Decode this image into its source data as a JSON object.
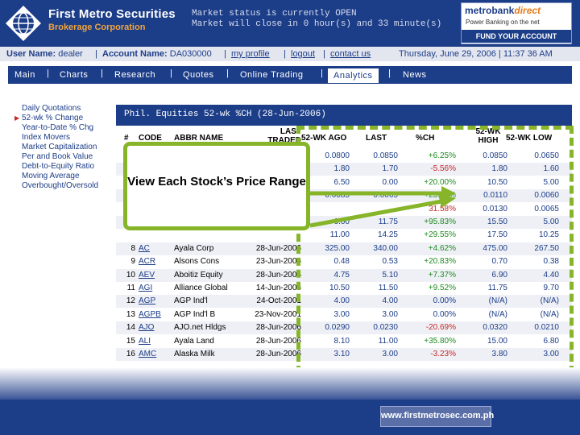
{
  "header": {
    "brand_name": "First Metro Securities",
    "brand_sub": "Brokerage Corporation",
    "market_status": "Market status is currently OPEN",
    "market_close": "Market will close in 0 hour(s) and 33 minute(s)",
    "ad": {
      "name_part1": "metrobank",
      "name_part2": "direct",
      "tagline": "Power Banking on the net",
      "cta": "FUND YOUR ACCOUNT"
    }
  },
  "userbar": {
    "user_label": "User Name:",
    "user_value": "dealer",
    "account_label": "Account Name:",
    "account_value": "DA030000",
    "links": {
      "profile": "my profile",
      "logout": "logout",
      "contact": "contact us"
    },
    "sep": "|",
    "datetime": "Thursday, June 29, 2006 | 11:37 36 AM"
  },
  "nav": {
    "items": [
      "Main",
      "Charts",
      "Research",
      "Quotes",
      "Online Trading",
      "Analytics",
      "News"
    ],
    "active": "Analytics",
    "sep": "|"
  },
  "left_menu": {
    "items": [
      "Daily Quotations",
      "52-wk % Change",
      "Year-to-Date % Chg",
      "Index Movers",
      "Market Capitalization",
      "Per and Book Value",
      "Debt-to-Equity Ratio",
      "Moving Average",
      "Overbought/Oversold"
    ],
    "active_index": 1
  },
  "table": {
    "title": "Phil. Equities 52-wk %CH (28-Jun-2006)",
    "headers": {
      "num": "#",
      "code": "CODE",
      "abbr": "ABBR NAME",
      "last_traded": "LAST TRADED",
      "ago": "52-WK AGO",
      "last": "LAST",
      "pch": "%CH",
      "high": "52-WK HIGH",
      "low": "52-WK LOW"
    },
    "rows": [
      {
        "n": "",
        "code": "",
        "name": "",
        "date": "",
        "ago": "0.0800",
        "last": "0.0850",
        "pch": "+6.25%",
        "high": "0.0850",
        "low": "0.0650",
        "dir": "pos"
      },
      {
        "n": "",
        "code": "",
        "name": "",
        "date": "",
        "ago": "1.80",
        "last": "1.70",
        "pch": "-5.56%",
        "high": "1.80",
        "low": "1.60",
        "dir": "neg"
      },
      {
        "n": "",
        "code": "",
        "name": "",
        "date": "",
        "ago": "6.50",
        "last": "0.00",
        "pch": "+20.00%",
        "high": "10.50",
        "low": "5.00",
        "dir": "pos"
      },
      {
        "n": "",
        "code": "",
        "name": "",
        "date": "",
        "ago": "0.0085",
        "last": "0.0065",
        "pch": "+23.53%",
        "high": "0.0110",
        "low": "0.0060",
        "dir": "pos"
      },
      {
        "n": "",
        "code": "",
        "name": "",
        "date": "",
        "ago": "",
        "last": "",
        "pch": "31.58%",
        "high": "0.0130",
        "low": "0.0065",
        "dir": "neg"
      },
      {
        "n": "",
        "code": "",
        "name": "",
        "date": "",
        "ago": "6.00",
        "last": "11.75",
        "pch": "+95.83%",
        "high": "15.50",
        "low": "5.00",
        "dir": "pos"
      },
      {
        "n": "",
        "code": "",
        "name": "",
        "date": "",
        "ago": "11.00",
        "last": "14.25",
        "pch": "+29.55%",
        "high": "17.50",
        "low": "10.25",
        "dir": "pos"
      },
      {
        "n": "8",
        "code": "AC",
        "name": "Ayala Corp",
        "date": "28-Jun-2006",
        "ago": "325.00",
        "last": "340.00",
        "pch": "+4.62%",
        "high": "475.00",
        "low": "267.50",
        "dir": "pos"
      },
      {
        "n": "9",
        "code": "ACR",
        "name": "Alsons Cons",
        "date": "23-Jun-2006",
        "ago": "0.48",
        "last": "0.53",
        "pch": "+20.83%",
        "high": "0.70",
        "low": "0.38",
        "dir": "pos"
      },
      {
        "n": "10",
        "code": "AEV",
        "name": "Aboitiz Equity",
        "date": "28-Jun-2006",
        "ago": "4.75",
        "last": "5.10",
        "pch": "+7.37%",
        "high": "6.90",
        "low": "4.40",
        "dir": "pos"
      },
      {
        "n": "11",
        "code": "AGI",
        "name": "Alliance Global",
        "date": "14-Jun-2006",
        "ago": "10.50",
        "last": "11.50",
        "pch": "+9.52%",
        "high": "11.75",
        "low": "9.70",
        "dir": "pos"
      },
      {
        "n": "12",
        "code": "AGP",
        "name": "AGP Ind'l",
        "date": "24-Oct-2001",
        "ago": "4.00",
        "last": "4.00",
        "pch": "0.00%",
        "high": "(N/A)",
        "low": "(N/A)",
        "dir": "zero"
      },
      {
        "n": "13",
        "code": "AGPB",
        "name": "AGP Ind'l B",
        "date": "23-Nov-2001",
        "ago": "3.00",
        "last": "3.00",
        "pch": "0.00%",
        "high": "(N/A)",
        "low": "(N/A)",
        "dir": "zero"
      },
      {
        "n": "14",
        "code": "AJO",
        "name": "AJO.net Hldgs",
        "date": "28-Jun-2006",
        "ago": "0.0290",
        "last": "0.0230",
        "pch": "-20.69%",
        "high": "0.0320",
        "low": "0.0210",
        "dir": "neg"
      },
      {
        "n": "15",
        "code": "ALI",
        "name": "Ayala Land",
        "date": "28-Jun-2006",
        "ago": "8.10",
        "last": "11.00",
        "pch": "+35.80%",
        "high": "15.00",
        "low": "6.80",
        "dir": "pos"
      },
      {
        "n": "16",
        "code": "AMC",
        "name": "Alaska Milk",
        "date": "28-Jun-2006",
        "ago": "3.10",
        "last": "3.00",
        "pch": "-3.23%",
        "high": "3.80",
        "low": "3.00",
        "dir": "neg"
      }
    ]
  },
  "callout": {
    "text": "View Each Stock’s Price Range"
  },
  "footer": {
    "url": "www.firstmetrosec.com.ph"
  },
  "colors": {
    "brand_blue": "#1c3d88",
    "accent_orange": "#f1a43a",
    "callout_green": "#86b52a",
    "positive": "#1f8a1f",
    "negative": "#c62828"
  }
}
